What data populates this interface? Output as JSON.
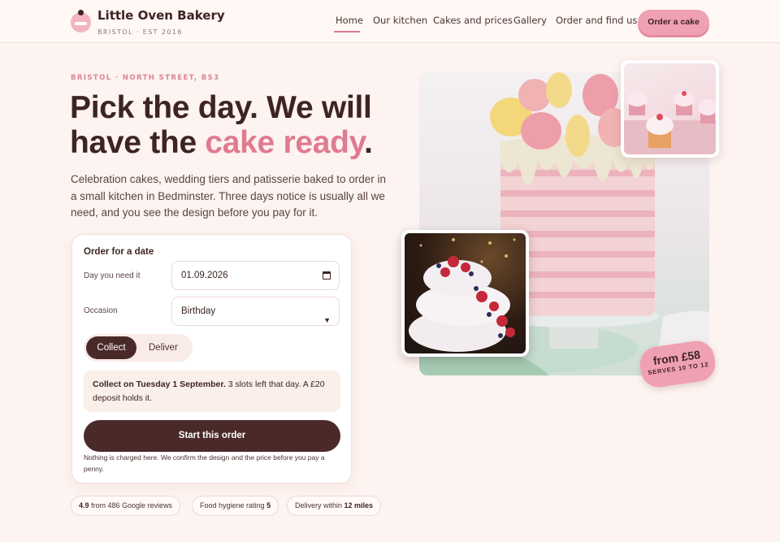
{
  "brand": {
    "name": "Little Oven Bakery",
    "tagline": "BRISTOL · EST 2016"
  },
  "nav": {
    "items": [
      {
        "label": "Home",
        "active": true
      },
      {
        "label": "Our kitchen"
      },
      {
        "label": "Cakes and prices"
      },
      {
        "label": "Gallery"
      },
      {
        "label": "Order and find us"
      }
    ],
    "cta_label": "Order a cake"
  },
  "hero": {
    "kicker": "BRISTOL · NORTH STREET, BS3",
    "headline_part1": "Pick the day. We will have the ",
    "headline_accent": "cake ready",
    "headline_end": ".",
    "lede": "Celebration cakes, wedding tiers and patisserie baked to order in a small kitchen in Bedminster. Three days notice is usually all we need, and you see the design before you pay for it."
  },
  "order_form": {
    "title": "Order for a date",
    "date_label": "Day you need it",
    "date_value": "01.09.2026",
    "occasion_label": "Occasion",
    "occasion_value": "Birthday",
    "toggle": {
      "selected": "Collect",
      "other": "Deliver"
    },
    "notice_bold": "Collect on Tuesday 1 September.",
    "notice_rest": " 3 slots left that day. A £20 deposit holds it.",
    "submit_label": "Start this order",
    "fine_print": "Nothing is charged here. We confirm the design and the price before you pay a penny."
  },
  "badges": [
    {
      "bold": "4.9",
      "text": " from 486 Google reviews"
    },
    {
      "text": "Food hygiene rating ",
      "bold": "5"
    },
    {
      "text": "Delivery within ",
      "bold": "12 miles"
    }
  ],
  "price_tag": {
    "price": "from £58",
    "serves": "SERVES 10 TO 12"
  },
  "colors": {
    "accent": "#e07b8f",
    "pink": "#f0a1b1",
    "dark": "#4a2a28",
    "background": "#fdf3f0"
  }
}
